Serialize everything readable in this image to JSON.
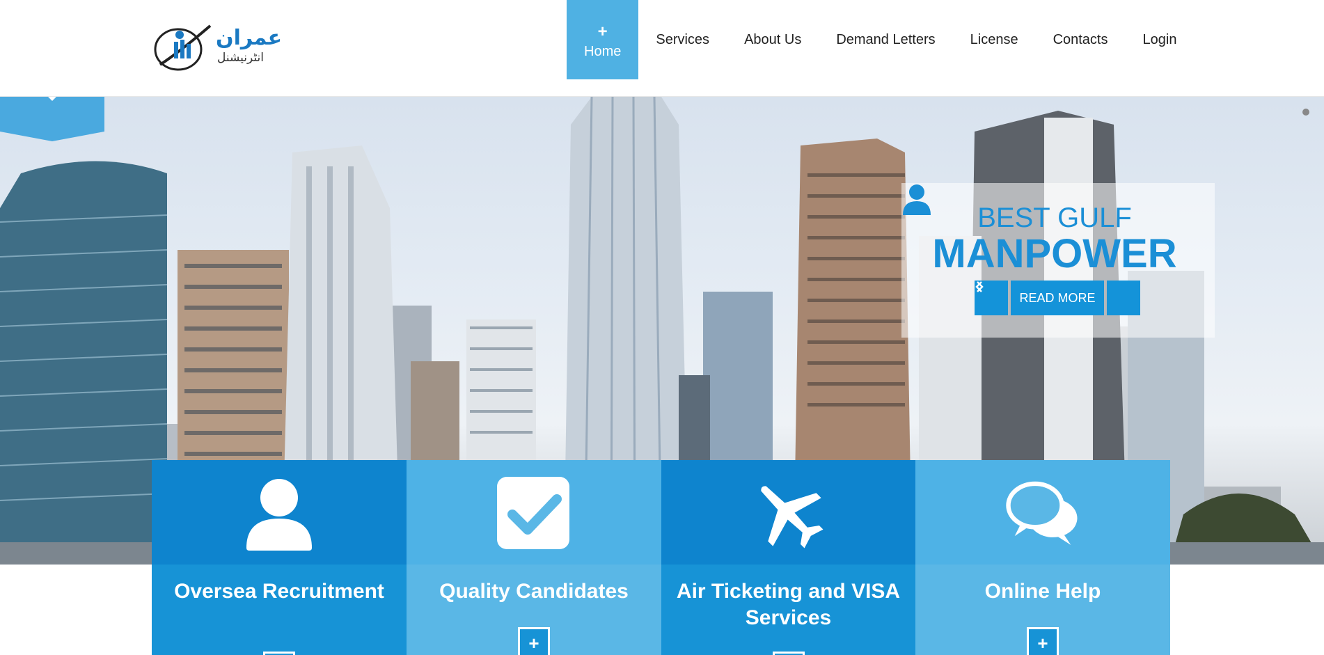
{
  "logo": {
    "name_urdu": "عمران",
    "tagline_urdu": "انٹرنیشنل"
  },
  "nav": {
    "items": [
      {
        "label": "Home",
        "active": true
      },
      {
        "label": "Services"
      },
      {
        "label": "About Us"
      },
      {
        "label": "Demand Letters"
      },
      {
        "label": "License"
      },
      {
        "label": "Contacts"
      },
      {
        "label": "Login"
      }
    ]
  },
  "hero": {
    "caption_line1": "BEST GULF",
    "caption_line2": "MANPOWER",
    "read_more": "READ MORE",
    "prev_icon": "chevron-left-icon",
    "next_icon": "chevron-right-icon"
  },
  "features": [
    {
      "title": "Oversea Recruitment",
      "icon": "user-icon"
    },
    {
      "title": "Quality Candidates",
      "icon": "checkmark-icon"
    },
    {
      "title": "Air Ticketing and VISA Services",
      "icon": "airplane-icon"
    },
    {
      "title": "Online Help",
      "icon": "chat-bubbles-icon"
    }
  ],
  "colors": {
    "accent": "#1493d9",
    "accent_light": "#5ab7e6",
    "nav_active": "#4fb1e3"
  }
}
